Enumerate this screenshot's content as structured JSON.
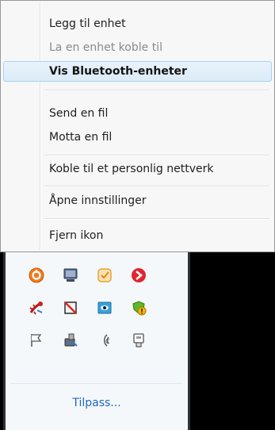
{
  "context_menu": {
    "items": [
      {
        "label": "Legg til enhet"
      },
      {
        "label": "La en enhet koble til"
      },
      {
        "label": "Vis Bluetooth-enheter"
      },
      {
        "label": "Send en fil"
      },
      {
        "label": "Motta en fil"
      },
      {
        "label": "Koble til et personlig nettverk"
      },
      {
        "label": "Åpne innstillinger"
      },
      {
        "label": "Fjern ikon"
      }
    ]
  },
  "tray_flyout": {
    "icons": [
      "orange-circle-icon",
      "monitor-icon",
      "orange-check-icon",
      "red-arrow-icon",
      "red-gecko-icon",
      "display-off-icon",
      "eye-window-icon",
      "green-shield-warning-icon",
      "flag-icon",
      "usb-device-icon",
      "wireless-signal-icon",
      "safely-remove-hardware-icon"
    ],
    "customize_label": "Tilpass..."
  },
  "colors": {
    "menu_background": "#f7f7f7",
    "menu_highlight": "#dcebf8",
    "disabled_text": "#8a8a8a",
    "link": "#1f66c4",
    "taskbar_background": "#000000"
  }
}
